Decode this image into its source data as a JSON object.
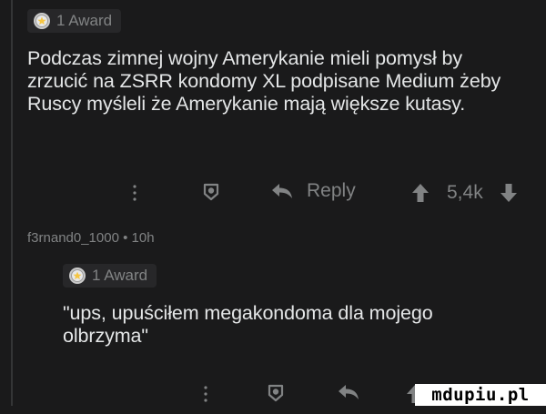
{
  "comment1": {
    "award": {
      "icon": "award-medal-icon",
      "label": "1 Award"
    },
    "body": "Podczas zimnej wojny Amerykanie mieli pomysł by zrzucić na ZSRR kondomy XL podpisane Medium żeby Ruscy myśleli że Amerykanie mają większe kutasy.",
    "actions": {
      "more_icon": "more-vertical-icon",
      "award_icon": "award-button-icon",
      "reply_icon": "reply-arrow-icon",
      "reply_label": "Reply",
      "upvote_icon": "upvote-arrow-icon",
      "score": "5,4k",
      "downvote_icon": "downvote-arrow-icon"
    }
  },
  "comment2": {
    "author": "f3rnand0_1000",
    "separator": "•",
    "age": "10h",
    "award": {
      "icon": "award-medal-icon",
      "label": "1 Award"
    },
    "body": "\"ups, upuściłem megakondoma dla mojego olbrzyma\"",
    "actions": {
      "more_icon": "more-vertical-icon",
      "award_icon": "award-button-icon",
      "reply_icon": "reply-arrow-icon",
      "upvote_icon": "upvote-arrow-icon"
    }
  },
  "watermark": {
    "text": "mdupiu.pl"
  },
  "colors": {
    "background": "#1a1a1b",
    "text": "#e4e6e7",
    "muted": "#818384",
    "chip": "#272729"
  }
}
